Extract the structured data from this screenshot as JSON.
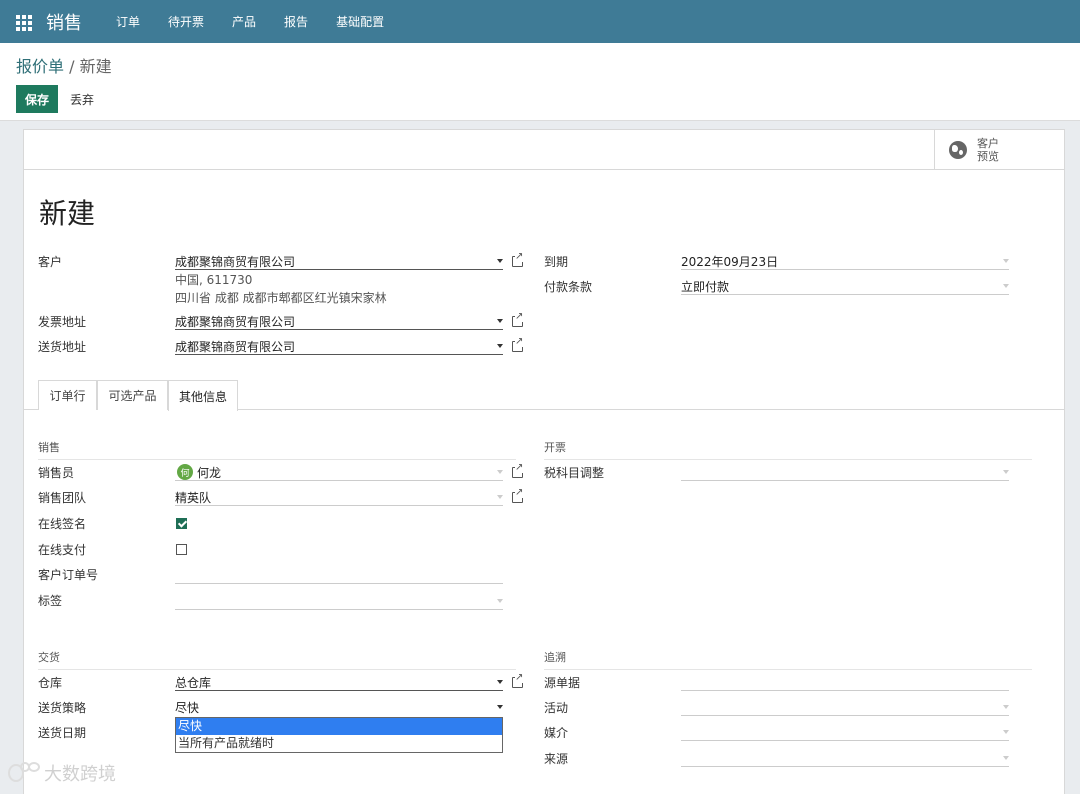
{
  "app": {
    "name": "销售"
  },
  "nav": [
    "订单",
    "待开票",
    "产品",
    "报告",
    "基础配置"
  ],
  "breadcrumb": {
    "parent": "报价单",
    "sep": "/",
    "current": "新建"
  },
  "actions": {
    "save": "保存",
    "discard": "丢弃"
  },
  "preview": {
    "line1": "客户",
    "line2": "预览"
  },
  "form": {
    "title": "新建",
    "customer_label": "客户",
    "customer": "成都聚锦商贸有限公司",
    "addr1": "中国, 611730",
    "addr2": "四川省 成都 成都市郫都区红光镇宋家林",
    "invoice_addr_label": "发票地址",
    "invoice_addr": "成都聚锦商贸有限公司",
    "delivery_addr_label": "送货地址",
    "delivery_addr": "成都聚锦商贸有限公司",
    "expiry_label": "到期",
    "expiry": "2022年09月23日",
    "terms_label": "付款条款",
    "terms": "立即付款"
  },
  "tabs": [
    "订单行",
    "可选产品",
    "其他信息"
  ],
  "other": {
    "sales_section": "销售",
    "salesperson_label": "销售员",
    "salesperson_initial": "何",
    "salesperson": "何龙",
    "team_label": "销售团队",
    "team": "精英队",
    "sign_label": "在线签名",
    "pay_label": "在线支付",
    "ref_label": "客户订单号",
    "tags_label": "标签",
    "invoice_section": "开票",
    "fiscal_label": "税科目调整",
    "delivery_section": "交货",
    "warehouse_label": "仓库",
    "warehouse": "总仓库",
    "policy_label": "送货策略",
    "policy": "尽快",
    "date_label": "送货日期",
    "tracking_section": "追溯",
    "source_label": "源单据",
    "campaign_label": "活动",
    "medium_label": "媒介",
    "origin_label": "来源"
  },
  "dropdown_options": [
    "尽快",
    "当所有产品就绪时"
  ],
  "watermark": "大数跨境"
}
